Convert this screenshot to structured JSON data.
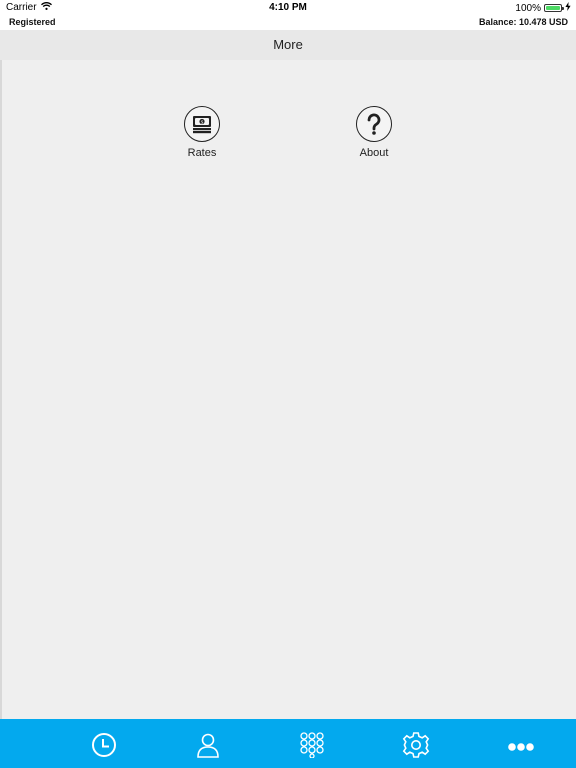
{
  "status_bar": {
    "carrier": "Carrier",
    "time": "4:10 PM",
    "battery_pct": "100%",
    "battery_color": "#4cd964"
  },
  "info_strip": {
    "registration": "Registered",
    "balance": "Balance: 10.478 USD"
  },
  "header": {
    "title": "More"
  },
  "menu": {
    "items": [
      {
        "label": "Rates",
        "icon": "money-stack-icon"
      },
      {
        "label": "About",
        "icon": "question-mark-icon"
      }
    ]
  },
  "tab_bar": {
    "background": "#03a9ee",
    "tabs": [
      {
        "icon": "clock-icon"
      },
      {
        "icon": "user-icon"
      },
      {
        "icon": "dialpad-icon"
      },
      {
        "icon": "gear-icon"
      },
      {
        "icon": "more-dots-icon",
        "selected": true
      }
    ]
  }
}
